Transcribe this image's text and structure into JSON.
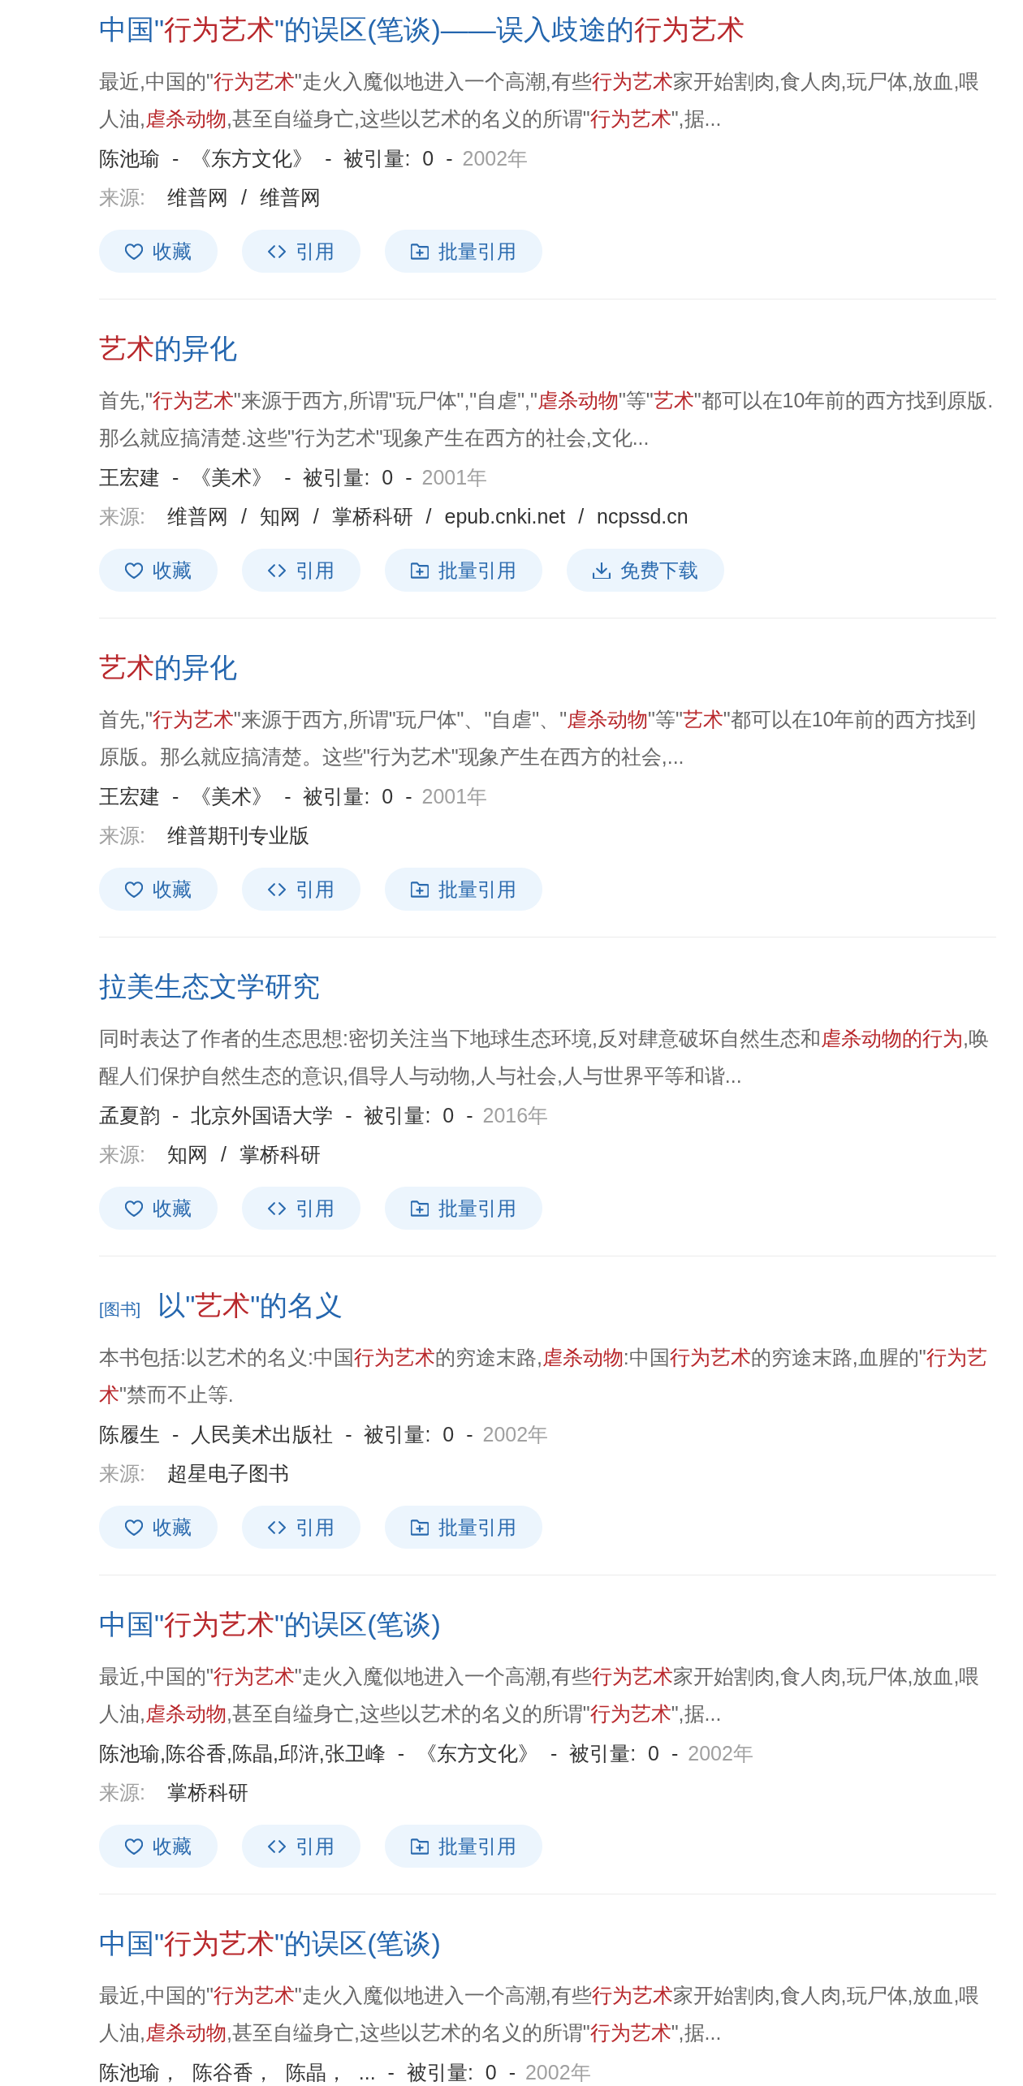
{
  "results": [
    {
      "title": [
        {
          "text": "中国\"",
          "highlighted": false
        },
        {
          "text": "行为艺术",
          "highlighted": true
        },
        {
          "text": "\"的误区(笔谈)——误入歧途的",
          "highlighted": false
        },
        {
          "text": "行为艺术",
          "highlighted": true
        }
      ],
      "snippet": [
        {
          "text": "最近,中国的\"",
          "highlighted": false
        },
        {
          "text": "行为艺术",
          "highlighted": true
        },
        {
          "text": "\"走火入魔似地进入一个高潮,有些",
          "highlighted": false
        },
        {
          "text": "行为艺术",
          "highlighted": true
        },
        {
          "text": "家开始割肉,食人肉,玩尸体,放血,喂人油,",
          "highlighted": false
        },
        {
          "text": "虐杀动物",
          "highlighted": true
        },
        {
          "text": ",甚至自缢身亡,这些以艺术的名义的所谓\"",
          "highlighted": false
        },
        {
          "text": "行为艺术",
          "highlighted": true
        },
        {
          "text": "\",据...",
          "highlighted": false
        }
      ],
      "byline": "陈池瑜 - 《东方文化》 - 被引量: 0 -",
      "year": "2002年",
      "source_label": "来源:",
      "sources": "维普网 / 维普网",
      "buttons": [
        {
          "kind": "heart",
          "label": "收藏"
        },
        {
          "kind": "code",
          "label": "引用"
        },
        {
          "kind": "folder-plus",
          "label": "批量引用"
        }
      ]
    },
    {
      "title": [
        {
          "text": "艺术",
          "highlighted": true
        },
        {
          "text": "的异化",
          "highlighted": false
        }
      ],
      "snippet": [
        {
          "text": "首先,\"",
          "highlighted": false
        },
        {
          "text": "行为艺术",
          "highlighted": true
        },
        {
          "text": "\"来源于西方,所谓\"玩尸体\",\"自虐\",\"",
          "highlighted": false
        },
        {
          "text": "虐杀动物",
          "highlighted": true
        },
        {
          "text": "\"等\"",
          "highlighted": false
        },
        {
          "text": "艺术",
          "highlighted": true
        },
        {
          "text": "\"都可以在10年前的西方找到原版.那么就应搞清楚.这些\"行为艺术\"现象产生在西方的社会,文化...",
          "highlighted": false
        }
      ],
      "byline": "王宏建 - 《美术》 - 被引量: 0 -",
      "year": "2001年",
      "source_label": "来源:",
      "sources": "维普网 / 知网 / 掌桥科研 / epub.cnki.net / ncpssd.cn",
      "buttons": [
        {
          "kind": "heart",
          "label": "收藏"
        },
        {
          "kind": "code",
          "label": "引用"
        },
        {
          "kind": "folder-plus",
          "label": "批量引用"
        },
        {
          "kind": "download",
          "label": "免费下载"
        }
      ]
    },
    {
      "title": [
        {
          "text": "艺术",
          "highlighted": true
        },
        {
          "text": "的异化",
          "highlighted": false
        }
      ],
      "snippet": [
        {
          "text": "首先,\"",
          "highlighted": false
        },
        {
          "text": "行为艺术",
          "highlighted": true
        },
        {
          "text": "\"来源于西方,所谓\"玩尸体\"、\"自虐\"、\"",
          "highlighted": false
        },
        {
          "text": "虐杀动物",
          "highlighted": true
        },
        {
          "text": "\"等\"",
          "highlighted": false
        },
        {
          "text": "艺术",
          "highlighted": true
        },
        {
          "text": "\"都可以在10年前的西方找到原版。那么就应搞清楚。这些\"行为艺术\"现象产生在西方的社会,...",
          "highlighted": false
        }
      ],
      "byline": "王宏建 - 《美术》 - 被引量: 0 -",
      "year": "2001年",
      "source_label": "来源:",
      "sources": "维普期刊专业版",
      "buttons": [
        {
          "kind": "heart",
          "label": "收藏"
        },
        {
          "kind": "code",
          "label": "引用"
        },
        {
          "kind": "folder-plus",
          "label": "批量引用"
        }
      ]
    },
    {
      "title": [
        {
          "text": "拉美生态文学研究",
          "highlighted": false
        }
      ],
      "snippet": [
        {
          "text": "同时表达了作者的生态思想:密切关注当下地球生态环境,反对肆意破坏自然生态和",
          "highlighted": false
        },
        {
          "text": "虐杀动物的行为",
          "highlighted": true
        },
        {
          "text": ",唤醒人们保护自然生态的意识,倡导人与动物,人与社会,人与世界平等和谐...",
          "highlighted": false
        }
      ],
      "byline": "孟夏韵 - 北京外国语大学 - 被引量: 0 -",
      "year": "2016年",
      "source_label": "来源:",
      "sources": "知网 / 掌桥科研",
      "buttons": [
        {
          "kind": "heart",
          "label": "收藏"
        },
        {
          "kind": "code",
          "label": "引用"
        },
        {
          "kind": "folder-plus",
          "label": "批量引用"
        }
      ]
    },
    {
      "tag": "[图书]",
      "title": [
        {
          "text": "以\"",
          "highlighted": false
        },
        {
          "text": "艺术",
          "highlighted": true
        },
        {
          "text": "\"的名义",
          "highlighted": false
        }
      ],
      "snippet": [
        {
          "text": "本书包括:以艺术的名义:中国",
          "highlighted": false
        },
        {
          "text": "行为艺术",
          "highlighted": true
        },
        {
          "text": "的穷途末路,",
          "highlighted": false
        },
        {
          "text": "虐杀动物",
          "highlighted": true
        },
        {
          "text": ":中国",
          "highlighted": false
        },
        {
          "text": "行为艺术",
          "highlighted": true
        },
        {
          "text": "的穷途末路,血腥的\"",
          "highlighted": false
        },
        {
          "text": "行为艺术",
          "highlighted": true
        },
        {
          "text": "\"禁而不止等.",
          "highlighted": false
        }
      ],
      "byline": "陈履生 - 人民美术出版社 - 被引量: 0 -",
      "year": "2002年",
      "source_label": "来源:",
      "sources": "超星电子图书",
      "buttons": [
        {
          "kind": "heart",
          "label": "收藏"
        },
        {
          "kind": "code",
          "label": "引用"
        },
        {
          "kind": "folder-plus",
          "label": "批量引用"
        }
      ]
    },
    {
      "title": [
        {
          "text": "中国\"",
          "highlighted": false
        },
        {
          "text": "行为艺术",
          "highlighted": true
        },
        {
          "text": "\"的误区(笔谈)",
          "highlighted": false
        }
      ],
      "snippet": [
        {
          "text": "最近,中国的\"",
          "highlighted": false
        },
        {
          "text": "行为艺术",
          "highlighted": true
        },
        {
          "text": "\"走火入魔似地进入一个高潮,有些",
          "highlighted": false
        },
        {
          "text": "行为艺术",
          "highlighted": true
        },
        {
          "text": "家开始割肉,食人肉,玩尸体,放血,喂人油,",
          "highlighted": false
        },
        {
          "text": "虐杀动物",
          "highlighted": true
        },
        {
          "text": ",甚至自缢身亡,这些以艺术的名义的所谓\"",
          "highlighted": false
        },
        {
          "text": "行为艺术",
          "highlighted": true
        },
        {
          "text": "\",据...",
          "highlighted": false
        }
      ],
      "byline": "陈池瑜,陈谷香,陈晶,邱浒,张卫峰 - 《东方文化》 - 被引量: 0 -",
      "year": "2002年",
      "source_label": "来源:",
      "sources": "掌桥科研",
      "buttons": [
        {
          "kind": "heart",
          "label": "收藏"
        },
        {
          "kind": "code",
          "label": "引用"
        },
        {
          "kind": "folder-plus",
          "label": "批量引用"
        }
      ]
    },
    {
      "title": [
        {
          "text": "中国\"",
          "highlighted": false
        },
        {
          "text": "行为艺术",
          "highlighted": true
        },
        {
          "text": "\"的误区(笔谈)",
          "highlighted": false
        }
      ],
      "snippet": [
        {
          "text": "最近,中国的\"",
          "highlighted": false
        },
        {
          "text": "行为艺术",
          "highlighted": true
        },
        {
          "text": "\"走火入魔似地进入一个高潮,有些",
          "highlighted": false
        },
        {
          "text": "行为艺术",
          "highlighted": true
        },
        {
          "text": "家开始割肉,食人肉,玩尸体,放血,喂人油,",
          "highlighted": false
        },
        {
          "text": "虐杀动物",
          "highlighted": true
        },
        {
          "text": ",甚至自缢身亡,这些以艺术的名义的所谓\"",
          "highlighted": false
        },
        {
          "text": "行为艺术",
          "highlighted": true
        },
        {
          "text": "\",据...",
          "highlighted": false
        }
      ],
      "byline": "陈池瑜， 陈谷香， 陈晶， ... - 被引量: 0 -",
      "year": "2002年"
    }
  ]
}
